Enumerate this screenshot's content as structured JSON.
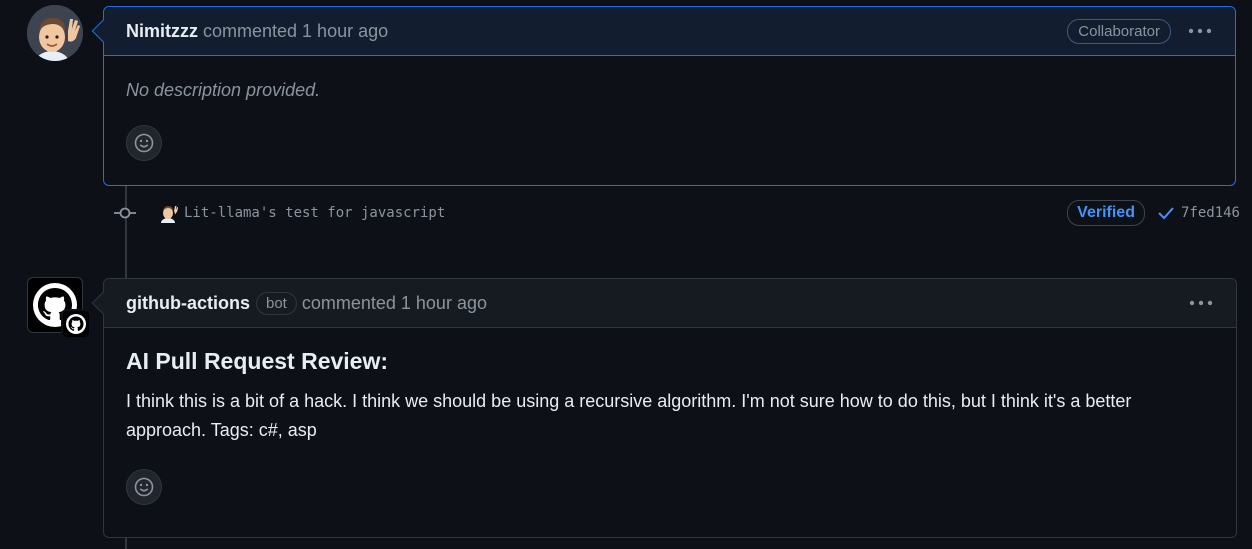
{
  "comment1": {
    "author": "Nimitzzz",
    "meta": "commented 1 hour ago",
    "role_badge": "Collaborator",
    "body": "No description provided."
  },
  "commit": {
    "message": "Lit-llama's test for javascript",
    "verified_label": "Verified",
    "sha": "7fed146"
  },
  "comment2": {
    "author": "github-actions",
    "bot_badge": "bot",
    "meta": "commented 1 hour ago",
    "title": "AI Pull Request Review:",
    "body": "I think this is a bit of a hack. I think we should be using a recursive algorithm. I'm not sure how to do this, but I think it's a better approach. Tags: c#, asp"
  },
  "icons": {
    "more": "kebab-horizontal-icon",
    "reaction": "smiley-icon",
    "commit": "git-commit-icon",
    "check": "check-icon",
    "github": "github-mark-icon"
  }
}
